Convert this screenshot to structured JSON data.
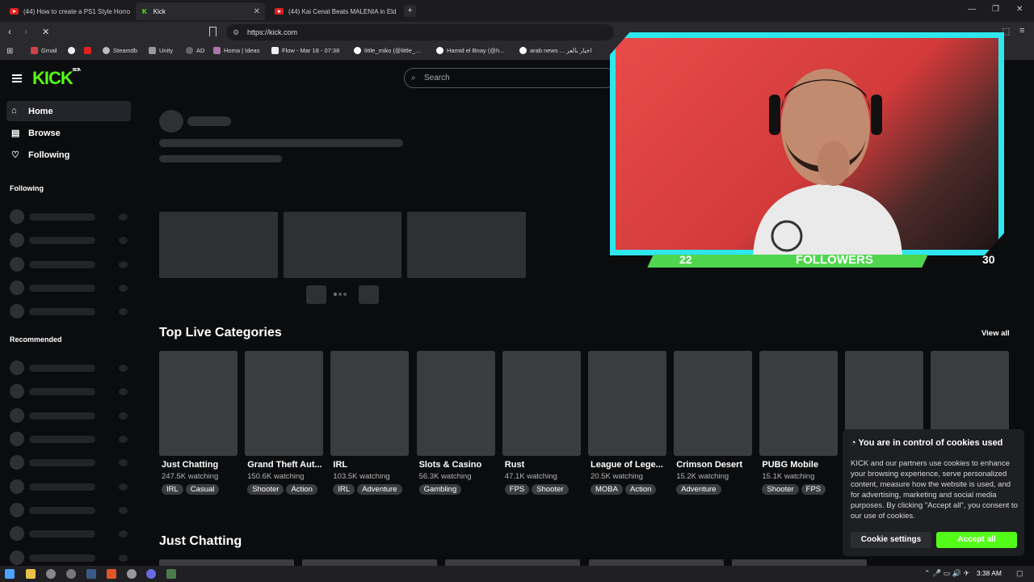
{
  "browser": {
    "tabs": [
      {
        "label": "(44) How to create a PS1 Style Horro"
      },
      {
        "label": "Kick"
      },
      {
        "label": "(44) Kai Cenat Beats MALENIA in Eld"
      }
    ],
    "url": "https://kick.com",
    "bookmarks": [
      "Gmail",
      "Steamdb",
      "Unity",
      "AD",
      "Homa | Ideas",
      "Flow - Mar 18 - 07:38",
      "little_miko (@little_...",
      "Hamid el Bnay (@h...",
      "arab news ... اخبار بالعر"
    ]
  },
  "site": {
    "logo": "KICK",
    "logo_badge": "BETA",
    "search_placeholder": "Search",
    "nav": {
      "home": "Home",
      "browse": "Browse",
      "following": "Following"
    },
    "sidebar_following": "Following",
    "sidebar_recommended": "Recommended",
    "section_title": "Top Live Categories",
    "view_all": "View all",
    "section2_title": "Just Chatting",
    "categories": [
      {
        "title": "Just Chatting",
        "watching": "247.5K watching",
        "tags": [
          "IRL",
          "Casual"
        ]
      },
      {
        "title": "Grand Theft Aut...",
        "watching": "150.6K watching",
        "tags": [
          "Shooter",
          "Action"
        ]
      },
      {
        "title": "IRL",
        "watching": "103.5K watching",
        "tags": [
          "IRL",
          "Adventure"
        ]
      },
      {
        "title": "Slots & Casino",
        "watching": "56.3K watching",
        "tags": [
          "Gambling"
        ]
      },
      {
        "title": "Rust",
        "watching": "47.1K watching",
        "tags": [
          "FPS",
          "Shooter"
        ]
      },
      {
        "title": "League of Lege...",
        "watching": "20.5K watching",
        "tags": [
          "MOBA",
          "Action"
        ]
      },
      {
        "title": "Crimson Desert",
        "watching": "15.2K watching",
        "tags": [
          "Adventure"
        ]
      },
      {
        "title": "PUBG Mobile",
        "watching": "15.1K watching",
        "tags": [
          "Shooter",
          "FPS"
        ]
      }
    ]
  },
  "overlay": {
    "followers_label": "FOLLOWERS",
    "left_count": "22",
    "right_count": "30"
  },
  "cookie": {
    "title": "You are in control of cookies used",
    "body": "KICK and our partners use cookies to enhance your browsing experience, serve personalized content, measure how the website is used, and for advertising, marketing and social media purposes. By clicking \"Accept all\", you consent to our use of cookies.",
    "settings": "Cookie settings",
    "accept": "Accept all"
  },
  "taskbar": {
    "time": "3:38 AM"
  },
  "colors": {
    "accent": "#53fc18",
    "cam_border": "#2ee6ee"
  }
}
